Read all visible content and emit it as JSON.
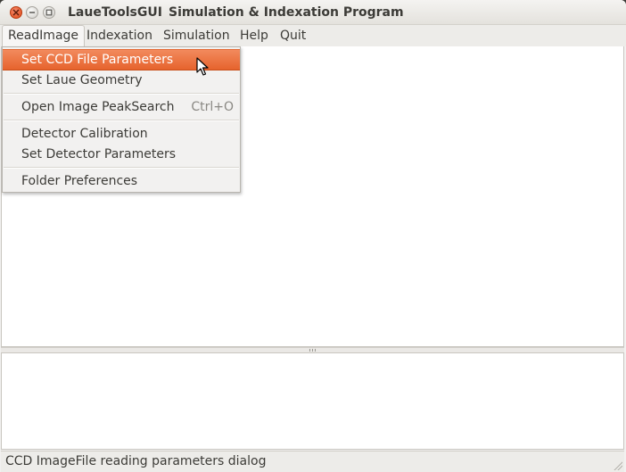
{
  "window": {
    "app_name": "LaueToolsGUI",
    "title": "Simulation & Indexation Program"
  },
  "menubar": {
    "items": [
      "ReadImage",
      "Indexation",
      "Simulation",
      "Help",
      "Quit"
    ],
    "open_menu": "ReadImage"
  },
  "readimage_menu": {
    "items": [
      {
        "label": "Set CCD File Parameters",
        "shortcut": ""
      },
      {
        "label": "Set Laue Geometry",
        "shortcut": ""
      },
      {
        "label": "Open Image PeakSearch",
        "shortcut": "Ctrl+O"
      },
      {
        "label": "Detector Calibration",
        "shortcut": ""
      },
      {
        "label": "Set Detector Parameters",
        "shortcut": ""
      },
      {
        "label": "Folder Preferences",
        "shortcut": ""
      }
    ],
    "highlighted": "Set CCD File Parameters"
  },
  "statusbar": {
    "text": "CCD ImageFile reading parameters dialog"
  },
  "icons": {
    "close": "close-icon",
    "minimize": "minimize-icon",
    "maximize": "maximize-icon",
    "cursor": "mouse-pointer-icon"
  },
  "colors": {
    "accent": "#e6632d",
    "close_button": "#df4a16",
    "menu_background": "#f2f1f0"
  }
}
